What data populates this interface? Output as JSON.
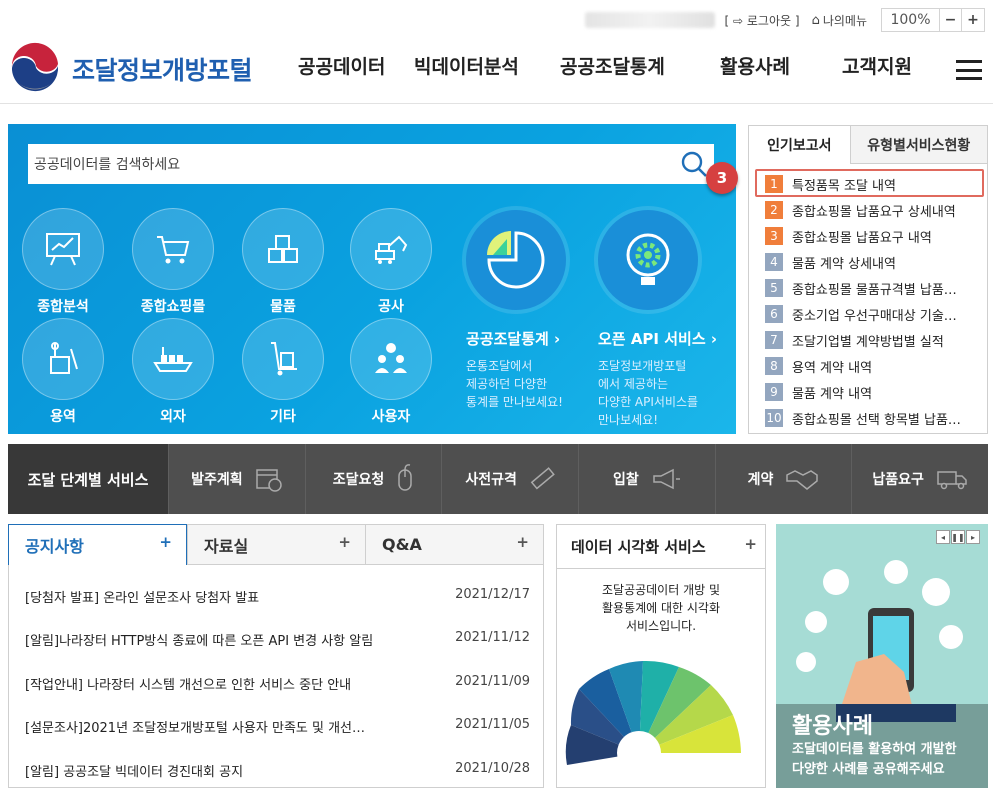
{
  "util": {
    "logout": "[ ⇨ 로그아웃 ]",
    "mymenu": "나의메뉴",
    "zoom": "100%",
    "minus": "−",
    "plus": "+"
  },
  "header": {
    "site_name": "조달정보개방포털",
    "nav": [
      "공공데이터",
      "빅데이터분석",
      "공공조달통계",
      "활용사례",
      "고객지원"
    ]
  },
  "hero": {
    "search_placeholder": "공공데이터를 검색하세요",
    "categories": [
      "종합분석",
      "종합쇼핑몰",
      "물품",
      "공사",
      "용역",
      "외자",
      "기타",
      "사용자"
    ],
    "stats": {
      "title": "공공조달통계 ›",
      "desc": [
        "온통조달에서",
        "제공하던 다양한",
        "통계를 만나보세요!"
      ]
    },
    "api": {
      "title": "오픈 API 서비스 ›",
      "desc": [
        "조달정보개방포털",
        "에서 제공하는",
        "다양한 API서비스를",
        "만나보세요!"
      ]
    }
  },
  "popular": {
    "tabs": [
      "인기보고서",
      "유형별서비스현황"
    ],
    "items": [
      {
        "n": "1",
        "label": "특정품목 조달 내역"
      },
      {
        "n": "2",
        "label": "종합쇼핑몰 납품요구 상세내역"
      },
      {
        "n": "3",
        "label": "종합쇼핑몰 납품요구 내역"
      },
      {
        "n": "4",
        "label": "물품 계약 상세내역"
      },
      {
        "n": "5",
        "label": "종합쇼핑몰 물품규격별 납품…"
      },
      {
        "n": "6",
        "label": "중소기업 우선구매대상 기술…"
      },
      {
        "n": "7",
        "label": "조달기업별 계약방법별 실적"
      },
      {
        "n": "8",
        "label": "용역 계약 내역"
      },
      {
        "n": "9",
        "label": "물품 계약 내역"
      },
      {
        "n": "10",
        "label": "종합쇼핑몰 선택 항목별 납품…"
      }
    ],
    "step_badge": "3"
  },
  "stage": {
    "title": "조달 단계별 서비스",
    "steps": [
      "발주계획",
      "조달요청",
      "사전규격",
      "입찰",
      "계약",
      "납품요구"
    ]
  },
  "notice": {
    "tabs": [
      "공지사항",
      "자료실",
      "Q&A"
    ],
    "plus": "+",
    "rows": [
      {
        "title": "[당첨자 발표] 온라인 설문조사 당첨자 발표",
        "date": "2021/12/17"
      },
      {
        "title": "[알림]나라장터 HTTP방식 종료에 따른 오픈 API 변경 사항 알림",
        "date": "2021/11/12"
      },
      {
        "title": "[작업안내] 나라장터 시스템 개선으로 인한 서비스 중단 안내",
        "date": "2021/11/09"
      },
      {
        "title": "[설문조사]2021년 조달정보개방포털 사용자 만족도 및 개선…",
        "date": "2021/11/05"
      },
      {
        "title": "[알림] 공공조달 빅데이터 경진대회 공지",
        "date": "2021/10/28"
      }
    ]
  },
  "viz": {
    "title": "데이터 시각화 서비스",
    "plus": "+",
    "desc": [
      "조달공공데이터 개방 및",
      "활용통계에 대한 시각화",
      "서비스입니다."
    ]
  },
  "cases": {
    "title": "활용사례",
    "desc": [
      "조달데이터를 활용하여 개발한",
      "다양한 사례를 공유해주세요"
    ],
    "ctrl": [
      "◂",
      "❚❚",
      "▸"
    ]
  },
  "colors": {
    "rank_top": "#f07e3b",
    "rank_rest": "#93a6bf",
    "accent": "#1f6fb8",
    "hero": "#0a9ad9",
    "highlight": "#e06a5e"
  }
}
